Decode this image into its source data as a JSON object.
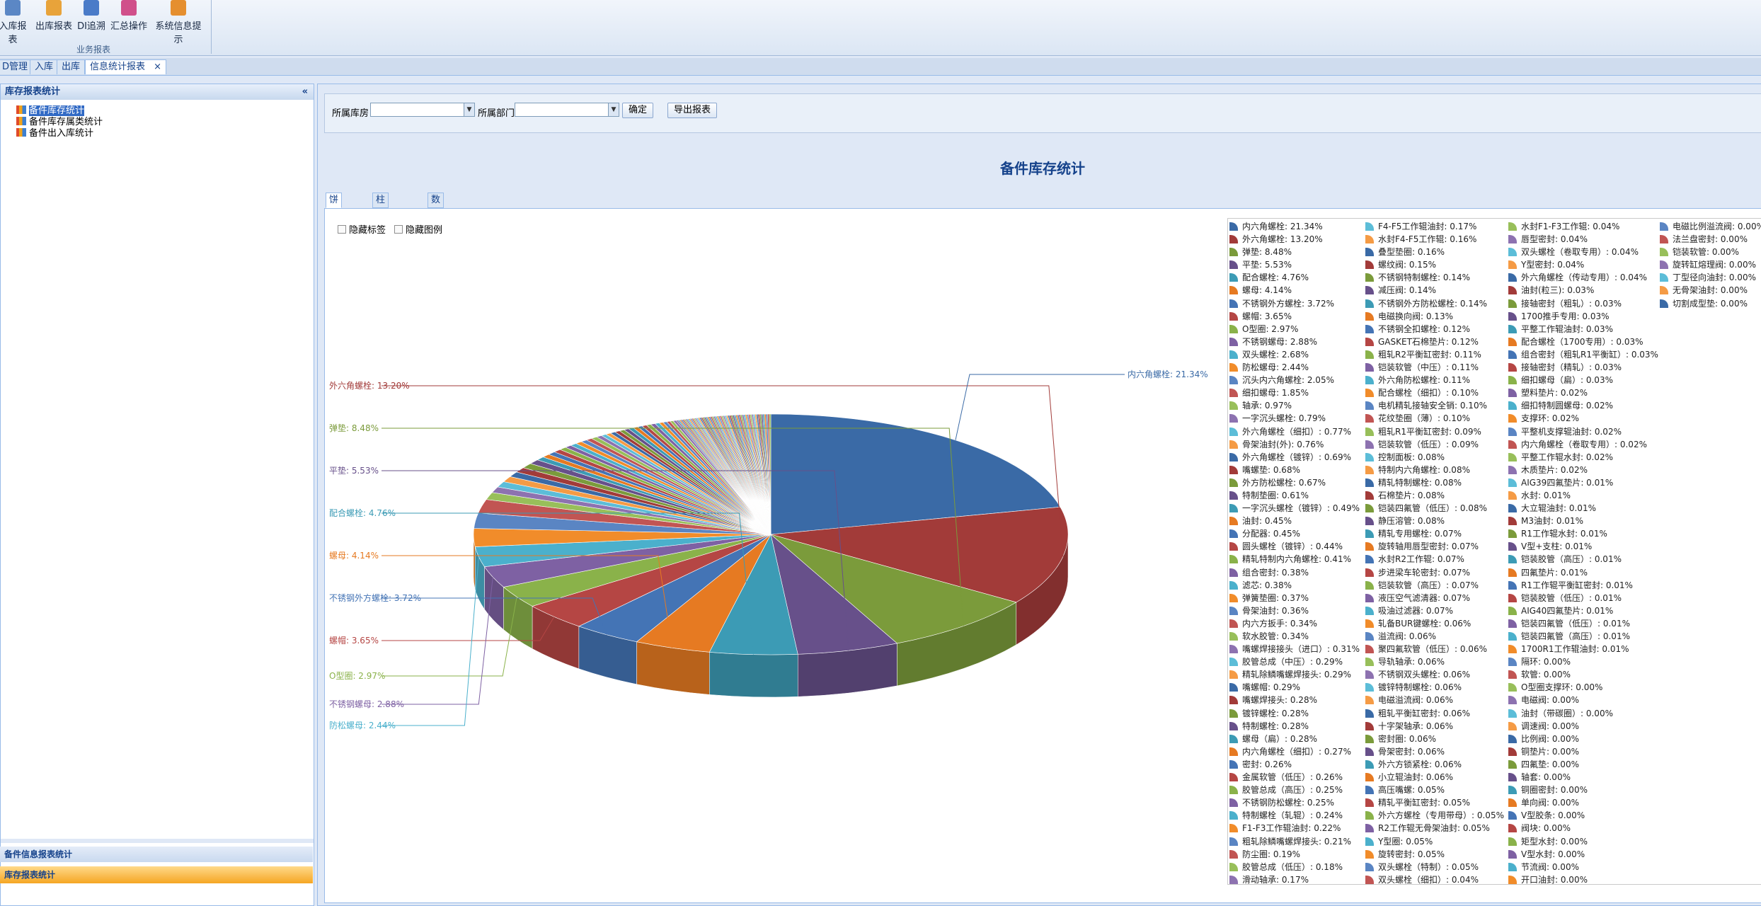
{
  "ribbon": {
    "buttons": [
      {
        "label": "入库报表",
        "icon": "database-report-icon",
        "color": "#5b87c5"
      },
      {
        "label": "出库报表",
        "icon": "outbound-report-icon",
        "color": "#e8a33a"
      },
      {
        "label": "DI追溯",
        "icon": "trace-icon",
        "color": "#4a7bc8"
      },
      {
        "label": "汇总操作",
        "icon": "summary-icon",
        "color": "#d04f8a"
      },
      {
        "label": "系统信息提示",
        "icon": "user-notice-icon",
        "color": "#e58f2f"
      }
    ],
    "group_label": "业务报表"
  },
  "tabs": [
    {
      "label": "D管理"
    },
    {
      "label": "入库"
    },
    {
      "label": "出库"
    },
    {
      "label": "信息统计报表",
      "active": true,
      "close": "×"
    }
  ],
  "left_panel": {
    "title": "库存报表统计",
    "collapse_glyph": "«",
    "tree": [
      {
        "label": "备件库存统计",
        "selected": true
      },
      {
        "label": "备件库存属类统计"
      },
      {
        "label": "备件出入库统计"
      }
    ],
    "accordion": [
      "备件信息报表统计",
      "库存报表统计"
    ]
  },
  "filter": {
    "warehouse_label": "所属库房",
    "department_label": "所属部门",
    "confirm_button": "确定",
    "export_button": "导出报表"
  },
  "report_title": "备件库存统计",
  "sub_tabs": [
    "饼图报表",
    "柱状图报表",
    "数据报表"
  ],
  "options": {
    "hide_labels": "隐藏标签",
    "hide_legend": "隐藏图例"
  },
  "chart_data": {
    "type": "pie",
    "title": "",
    "series": [
      {
        "name": "内六角螺栓",
        "value": 21.34,
        "label": "内六角螺栓: 21.34%"
      },
      {
        "name": "外六角螺栓",
        "value": 13.2,
        "label": "外六角螺栓: 13.20%"
      },
      {
        "name": "弹垫",
        "value": 8.48,
        "label": "弹垫: 8.48%"
      },
      {
        "name": "平垫",
        "value": 5.53,
        "label": "平垫: 5.53%"
      },
      {
        "name": "配合螺栓",
        "value": 4.76,
        "label": "配合螺栓: 4.76%"
      },
      {
        "name": "螺母",
        "value": 4.14,
        "label": "螺母: 4.14%"
      },
      {
        "name": "不锈钢外方螺栓",
        "value": 3.72,
        "label": "不锈钢外方螺栓: 3.72%"
      },
      {
        "name": "螺帽",
        "value": 3.65,
        "label": "螺帽: 3.65%"
      },
      {
        "name": "O型圈",
        "value": 2.97,
        "label": "O型圈: 2.97%"
      },
      {
        "name": "不锈钢螺母",
        "value": 2.88,
        "label": "不锈钢螺母: 2.88%"
      },
      {
        "name": "双头螺栓",
        "value": 2.68,
        "label": "双头螺栓: 2.68%"
      },
      {
        "name": "防松螺母",
        "value": 2.44,
        "label": "防松螺母: 2.44%"
      },
      {
        "name": "沉头内六角螺栓",
        "value": 2.05,
        "label": "沉头内六角螺栓: 2.05%"
      },
      {
        "name": "细扣螺母",
        "value": 1.85,
        "label": "细扣螺母: 1.85%"
      },
      {
        "name": "轴承",
        "value": 0.97,
        "label": "轴承: 0.97%"
      },
      {
        "name": "一字沉头螺栓",
        "value": 0.79,
        "label": "一字沉头螺栓: 0.79%"
      },
      {
        "name": "外六角螺栓（细扣）",
        "value": 0.77,
        "label": "外六角螺栓（细扣）: 0.77%"
      },
      {
        "name": "骨架油封(外)",
        "value": 0.76,
        "label": "骨架油封(外): 0.76%"
      },
      {
        "name": "外六角螺栓（镀锌）",
        "value": 0.69,
        "label": "外六角螺栓（镀锌）: 0.69%"
      },
      {
        "name": "嘴螺垫",
        "value": 0.68,
        "label": "嘴螺垫: 0.68%"
      },
      {
        "name": "外方防松螺栓",
        "value": 0.67,
        "label": "外方防松螺栓: 0.67%"
      },
      {
        "name": "特制垫圈",
        "value": 0.61,
        "label": "特制垫圈: 0.61%"
      },
      {
        "name": "一字沉头螺栓（镀锌）",
        "value": 0.49,
        "label": "一字沉头螺栓（镀锌）: 0.49%"
      },
      {
        "name": "油封",
        "value": 0.45,
        "label": "油封: 0.45%"
      },
      {
        "name": "分配器",
        "value": 0.45,
        "label": "分配器: 0.45%"
      },
      {
        "name": "圆头螺栓（镀锌）",
        "value": 0.44,
        "label": "圆头螺栓（镀锌）: 0.44%"
      },
      {
        "name": "精轧特制内六角螺栓",
        "value": 0.41,
        "label": "精轧特制内六角螺栓: 0.41%"
      },
      {
        "name": "组合密封",
        "value": 0.38,
        "label": "组合密封: 0.38%"
      },
      {
        "name": "滤芯",
        "value": 0.38,
        "label": "滤芯: 0.38%"
      },
      {
        "name": "弹簧垫圈",
        "value": 0.37,
        "label": "弹簧垫圈: 0.37%"
      },
      {
        "name": "骨架油封",
        "value": 0.36,
        "label": "骨架油封: 0.36%"
      },
      {
        "name": "内六方扳手",
        "value": 0.34,
        "label": "内六方扳手: 0.34%"
      },
      {
        "name": "软水胶管",
        "value": 0.34,
        "label": "软水胶管: 0.34%"
      },
      {
        "name": "嘴螺焊接接头（进口）",
        "value": 0.31,
        "label": "嘴螺焊接接头（进口）: 0.31%"
      },
      {
        "name": "胶管总成（中压）",
        "value": 0.29,
        "label": "胶管总成（中压）: 0.29%"
      },
      {
        "name": "精轧除鳞嘴螺焊接头",
        "value": 0.29,
        "label": "精轧除鳞嘴螺焊接头: 0.29%"
      },
      {
        "name": "嘴螺帽",
        "value": 0.29,
        "label": "嘴螺帽: 0.29%"
      },
      {
        "name": "嘴螺焊接头",
        "value": 0.28,
        "label": "嘴螺焊接头: 0.28%"
      },
      {
        "name": "镀锌螺栓",
        "value": 0.28,
        "label": "镀锌螺栓: 0.28%"
      },
      {
        "name": "特制螺栓",
        "value": 0.28,
        "label": "特制螺栓: 0.28%"
      },
      {
        "name": "螺母（扁）",
        "value": 0.28,
        "label": "螺母（扁）: 0.28%"
      },
      {
        "name": "内六角螺栓（细扣）",
        "value": 0.27,
        "label": "内六角螺栓（细扣）: 0.27%"
      },
      {
        "name": "密封",
        "value": 0.26,
        "label": "密封: 0.26%"
      },
      {
        "name": "金属软管（低压）",
        "value": 0.26,
        "label": "金属软管（低压）: 0.26%"
      },
      {
        "name": "胶管总成（高压）",
        "value": 0.25,
        "label": "胶管总成（高压）: 0.25%"
      },
      {
        "name": "不锈钢防松螺栓",
        "value": 0.25,
        "label": "不锈钢防松螺栓: 0.25%"
      },
      {
        "name": "特制螺栓（轧辊）",
        "value": 0.24,
        "label": "特制螺栓（轧辊）: 0.24%"
      },
      {
        "name": "F1-F3工作辊油封",
        "value": 0.22,
        "label": "F1-F3工作辊油封: 0.22%"
      },
      {
        "name": "粗轧除鳞嘴螺焊接头",
        "value": 0.21,
        "label": "粗轧除鳞嘴螺焊接头: 0.21%"
      },
      {
        "name": "防尘圈",
        "value": 0.19,
        "label": "防尘圈: 0.19%"
      },
      {
        "name": "胶管总成（低压）",
        "value": 0.18,
        "label": "胶管总成（低压）: 0.18%"
      },
      {
        "name": "滑动轴承",
        "value": 0.17,
        "label": "滑动轴承: 0.17%"
      }
    ],
    "legend_items": [
      [
        "内六角螺栓: 21.34%",
        "外六角螺栓: 13.20%",
        "弹垫: 8.48%",
        "平垫: 5.53%",
        "配合螺栓: 4.76%",
        "螺母: 4.14%",
        "不锈钢外方螺栓: 3.72%",
        "螺帽: 3.65%",
        "O型圈: 2.97%",
        "不锈钢螺母: 2.88%",
        "双头螺栓: 2.68%",
        "防松螺母: 2.44%",
        "沉头内六角螺栓: 2.05%",
        "细扣螺母: 1.85%",
        "轴承: 0.97%",
        "一字沉头螺栓: 0.79%",
        "外六角螺栓（细扣）: 0.77%",
        "骨架油封(外): 0.76%",
        "外六角螺栓（镀锌）: 0.69%",
        "嘴螺垫: 0.68%",
        "外方防松螺栓: 0.67%",
        "特制垫圈: 0.61%",
        "一字沉头螺栓（镀锌）: 0.49%",
        "油封: 0.45%",
        "分配器: 0.45%",
        "圆头螺栓（镀锌）: 0.44%",
        "精轧特制内六角螺栓: 0.41%",
        "组合密封: 0.38%",
        "滤芯: 0.38%",
        "弹簧垫圈: 0.37%",
        "骨架油封: 0.36%",
        "内六方扳手: 0.34%",
        "软水胶管: 0.34%",
        "嘴螺焊接接头（进口）: 0.31%",
        "胶管总成（中压）: 0.29%",
        "精轧除鳞嘴螺焊接头: 0.29%",
        "嘴螺帽: 0.29%",
        "嘴螺焊接头: 0.28%",
        "镀锌螺栓: 0.28%",
        "特制螺栓: 0.28%",
        "螺母（扁）: 0.28%",
        "内六角螺栓（细扣）: 0.27%",
        "密封: 0.26%",
        "金属软管（低压）: 0.26%",
        "胶管总成（高压）: 0.25%",
        "不锈钢防松螺栓: 0.25%",
        "特制螺栓（轧辊）: 0.24%",
        "F1-F3工作辊油封: 0.22%",
        "粗轧除鳞嘴螺焊接头: 0.21%",
        "防尘圈: 0.19%",
        "胶管总成（低压）: 0.18%",
        "滑动轴承: 0.17%"
      ],
      [
        "F4-F5工作辊油封: 0.17%",
        "水封F4-F5工作辊: 0.16%",
        "叠型垫圈: 0.16%",
        "螺纹阀: 0.15%",
        "不锈钢特制螺栓: 0.14%",
        "减压阀: 0.14%",
        "不锈钢外方防松螺栓: 0.14%",
        "电磁换向阀: 0.13%",
        "不锈钢全扣螺栓: 0.12%",
        "GASKET石棉垫片: 0.12%",
        "粗轧R2平衡缸密封: 0.11%",
        "铠装软管（中压）: 0.11%",
        "外六角防松螺栓: 0.11%",
        "配合螺栓（细扣）: 0.10%",
        "电机精轧接轴安全销: 0.10%",
        "花纹垫圈（薄）: 0.10%",
        "粗轧R1平衡缸密封: 0.09%",
        "铠装软管（低压）: 0.09%",
        "控制面板: 0.08%",
        "特制内六角螺栓: 0.08%",
        "精轧特制螺栓: 0.08%",
        "石棉垫片: 0.08%",
        "铠装四氟管（低压）: 0.08%",
        "静压溶管: 0.08%",
        "精轧专用螺栓: 0.07%",
        "旋转轴用唇型密封: 0.07%",
        "水封R2工作辊: 0.07%",
        "步进梁车轮密封: 0.07%",
        "铠装软管（高压）: 0.07%",
        "液压空气滤清器: 0.07%",
        "吸油过滤器: 0.07%",
        "轧备BUR键螺栓: 0.06%",
        "溢流阀: 0.06%",
        "聚四氟软管（低压）: 0.06%",
        "导轨轴承: 0.06%",
        "不锈钢双头螺栓: 0.06%",
        "镀锌特制螺栓: 0.06%",
        "电磁溢流阀: 0.06%",
        "粗轧平衡缸密封: 0.06%",
        "十字架轴承: 0.06%",
        "密封圈: 0.06%",
        "骨架密封: 0.06%",
        "外六方锁紧栓: 0.06%",
        "小立辊油封: 0.06%",
        "高压嘴螺: 0.05%",
        "精轧平衡缸密封: 0.05%",
        "外六方螺栓（专用带母）: 0.05%",
        "R2工作辊无骨架油封: 0.05%",
        "Y型圈: 0.05%",
        "旋转密封: 0.05%",
        "双头螺栓（特制）: 0.05%",
        "双头螺栓（细扣）: 0.04%"
      ],
      [
        "水封F1-F3工作辊: 0.04%",
        "唇型密封: 0.04%",
        "双头螺栓（卷取专用）: 0.04%",
        "Y型密封: 0.04%",
        "外六角螺栓（传动专用）: 0.04%",
        "油封(粒三): 0.03%",
        "接轴密封（粗轧）: 0.03%",
        "1700推手专用: 0.03%",
        "平整工作辊油封: 0.03%",
        "配合螺栓（1700专用）: 0.03%",
        "组合密封（粗轧R1平衡缸）: 0.03%",
        "接轴密封（精轧）: 0.03%",
        "细扣螺母（扁）: 0.03%",
        "塑料垫片: 0.02%",
        "细扣特制圆螺母: 0.02%",
        "支撑环: 0.02%",
        "平整机支撑辊油封: 0.02%",
        "内六角螺栓（卷取专用）: 0.02%",
        "平整工作辊水封: 0.02%",
        "木质垫片: 0.02%",
        "AIG39四氟垫片: 0.01%",
        "水封: 0.01%",
        "大立辊油封: 0.01%",
        "M3油封: 0.01%",
        "R1工作辊水封: 0.01%",
        "V型+支柱: 0.01%",
        "铠装胶管（高压）: 0.01%",
        "四氟垫片: 0.01%",
        "R1工作辊平衡缸密封: 0.01%",
        "铠装胶管（低压）: 0.01%",
        "AIG40四氟垫片: 0.01%",
        "铠装四氟管（低压）: 0.01%",
        "铠装四氟管（高压）: 0.01%",
        "1700R1工作辊油封: 0.01%",
        "隔环: 0.00%",
        "软管: 0.00%",
        "O型圈支撑环: 0.00%",
        "电磁阀: 0.00%",
        "油封（带碳圈）: 0.00%",
        "调速阀: 0.00%",
        "比例阀: 0.00%",
        "铜垫片: 0.00%",
        "四氟垫: 0.00%",
        "轴套: 0.00%",
        "铜圈密封: 0.00%",
        "单向阀: 0.00%",
        "V型胶条: 0.00%",
        "阀块: 0.00%",
        "矩型水封: 0.00%",
        "V型水封: 0.00%",
        "节流阀: 0.00%",
        "开口油封: 0.00%"
      ],
      [
        "电磁比例溢流阀: 0.00%",
        "法兰盘密封: 0.00%",
        "铠装软管: 0.00%",
        "旋转缸熔理阀: 0.00%",
        "丁型径向油封: 0.00%",
        "无骨架油封: 0.00%",
        "切割成型垫: 0.00%"
      ]
    ],
    "pie_labels": [
      "外六角螺栓: 13.20%",
      "弹垫: 8.48%",
      "平垫: 5.53%",
      "配合螺栓: 4.76%",
      "螺母: 4.14%",
      "不锈钢外方螺栓: 3.72%",
      "螺帽: 3.65%",
      "O型圈: 2.97%",
      "不锈钢螺母: 2.88%",
      "防松螺母: 2.44%",
      "内六角螺栓: 21.34%"
    ],
    "colors": [
      "#3a6aa6",
      "#a23b39",
      "#7b9b3b",
      "#67508a",
      "#3c9bb5",
      "#e67a22",
      "#4474b5",
      "#b54644",
      "#8ab24a",
      "#7e61a3",
      "#4bb0cc",
      "#f18c2a",
      "#5a85c3",
      "#c15553",
      "#98bf5a",
      "#8d72b0",
      "#5cbdd8",
      "#f59b45"
    ]
  }
}
